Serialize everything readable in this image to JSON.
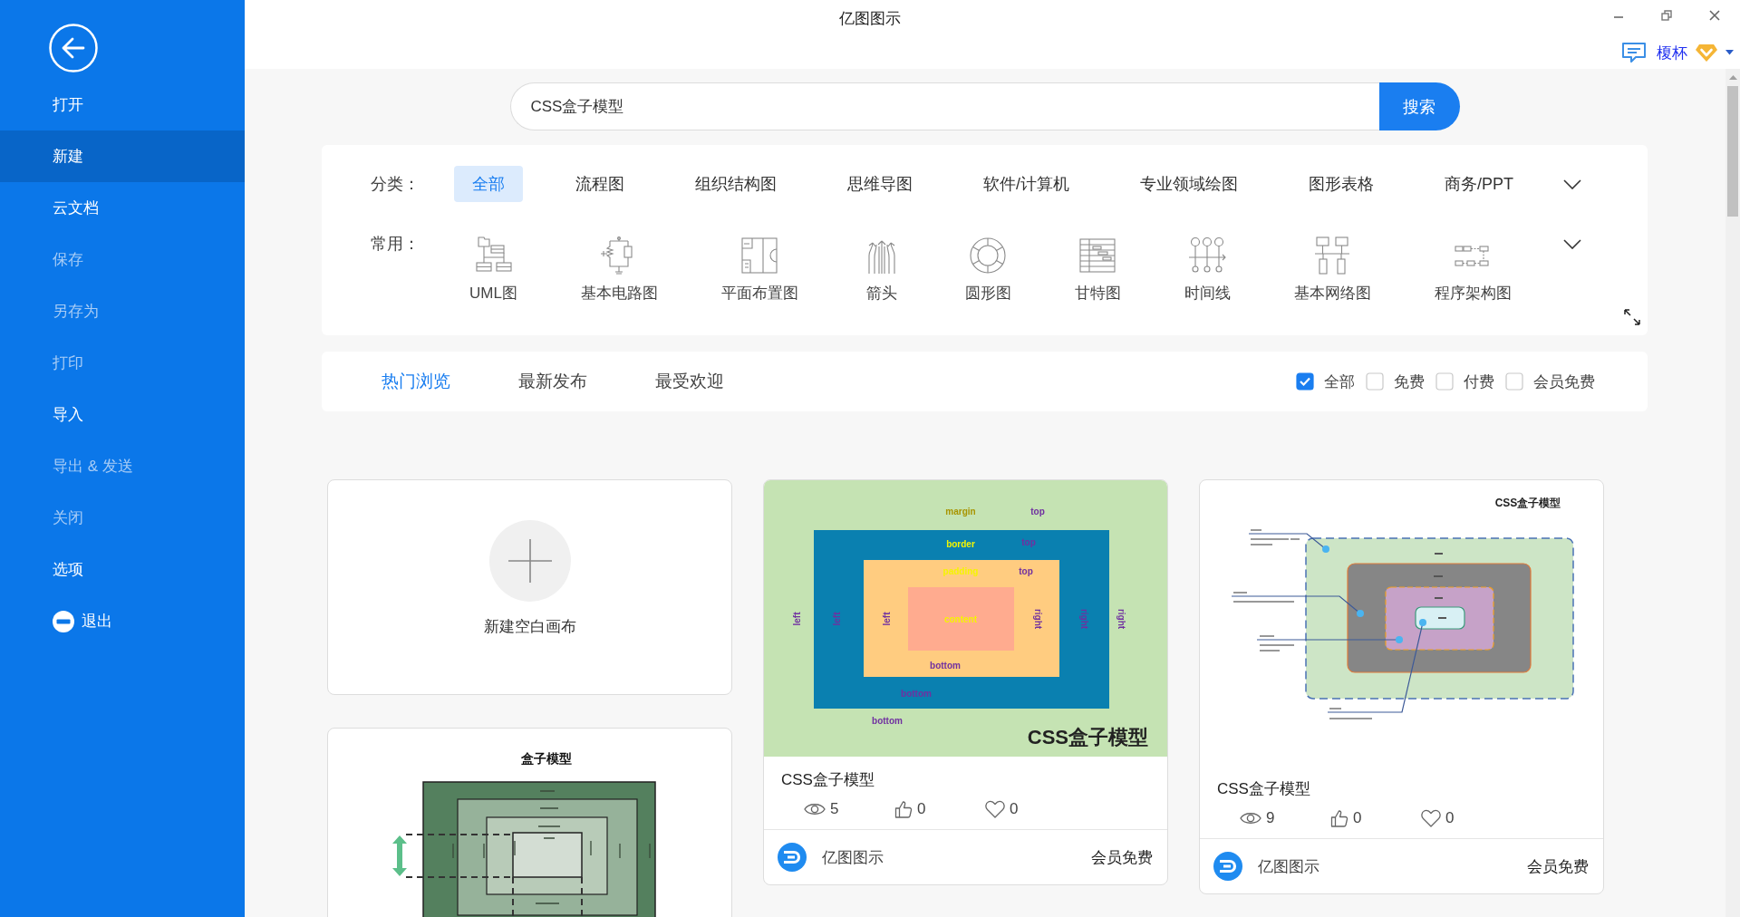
{
  "window": {
    "title": "亿图图示"
  },
  "sidebar": {
    "items": [
      {
        "label": "打开",
        "kind": "plain",
        "selected": false,
        "disabled": false
      },
      {
        "label": "新建",
        "kind": "plain",
        "selected": true,
        "disabled": false
      },
      {
        "label": "云文档",
        "kind": "plain",
        "selected": false,
        "disabled": false
      },
      {
        "label": "保存",
        "kind": "plain",
        "selected": false,
        "disabled": true
      },
      {
        "label": "另存为",
        "kind": "plain",
        "selected": false,
        "disabled": true
      },
      {
        "label": "打印",
        "kind": "plain",
        "selected": false,
        "disabled": true
      },
      {
        "label": "导入",
        "kind": "plain",
        "selected": false,
        "disabled": false
      },
      {
        "label": "导出 & 发送",
        "kind": "plain",
        "selected": false,
        "disabled": true
      },
      {
        "label": "关闭",
        "kind": "plain",
        "selected": false,
        "disabled": true
      },
      {
        "label": "选项",
        "kind": "plain",
        "selected": false,
        "disabled": false
      },
      {
        "label": "退出",
        "kind": "exit",
        "selected": false,
        "disabled": false
      }
    ]
  },
  "account": {
    "name": "榎杯"
  },
  "search": {
    "value": "CSS盒子模型",
    "button": "搜索"
  },
  "categories": {
    "label": "分类：",
    "items": [
      {
        "label": "全部",
        "selected": true
      },
      {
        "label": "流程图",
        "selected": false
      },
      {
        "label": "组织结构图",
        "selected": false
      },
      {
        "label": "思维导图",
        "selected": false
      },
      {
        "label": "软件/计算机",
        "selected": false
      },
      {
        "label": "专业领域绘图",
        "selected": false
      },
      {
        "label": "图形表格",
        "selected": false
      },
      {
        "label": "商务/PPT",
        "selected": false
      }
    ]
  },
  "common": {
    "label": "常用：",
    "items": [
      {
        "label": "UML图",
        "kind": "uml"
      },
      {
        "label": "基本电路图",
        "kind": "circuit"
      },
      {
        "label": "平面布置图",
        "kind": "floorplan"
      },
      {
        "label": "箭头",
        "kind": "arrows"
      },
      {
        "label": "圆形图",
        "kind": "circle"
      },
      {
        "label": "甘特图",
        "kind": "gantt"
      },
      {
        "label": "时间线",
        "kind": "timeline"
      },
      {
        "label": "基本网络图",
        "kind": "network"
      },
      {
        "label": "程序架构图",
        "kind": "architecture"
      }
    ]
  },
  "tabs": [
    {
      "label": "热门浏览",
      "selected": true
    },
    {
      "label": "最新发布",
      "selected": false
    },
    {
      "label": "最受欢迎",
      "selected": false
    }
  ],
  "filters": [
    {
      "label": "全部",
      "checked": true
    },
    {
      "label": "免费",
      "checked": false
    },
    {
      "label": "付费",
      "checked": false
    },
    {
      "label": "会员免费",
      "checked": false
    }
  ],
  "templates": [
    {
      "kind": "blank",
      "label": "新建空白画布"
    },
    {
      "kind": "colored",
      "thumbnail": {
        "layers": [
          {
            "name": "margin",
            "top": "top",
            "left": "left",
            "right": "right",
            "bottom": "bottom"
          },
          {
            "name": "border",
            "top": "top",
            "left": "left",
            "right": "right",
            "bottom": "bottom"
          },
          {
            "name": "padding",
            "top": "top",
            "left": "left",
            "right": "right",
            "bottom": "bottom"
          }
        ],
        "content": "content",
        "caption": "CSS盒子模型"
      },
      "title": "CSS盒子模型",
      "views": "5",
      "likes": "0",
      "favorites": "0",
      "author": "亿图图示",
      "price": "会员免费"
    },
    {
      "kind": "annotated",
      "thumbnail": {
        "caption": "CSS盒子模型"
      },
      "title": "CSS盒子模型",
      "views": "9",
      "likes": "0",
      "favorites": "0",
      "author": "亿图图示",
      "price": "会员免费"
    },
    {
      "kind": "green",
      "thumbnail": {
        "caption": "盒子模型"
      }
    }
  ]
}
